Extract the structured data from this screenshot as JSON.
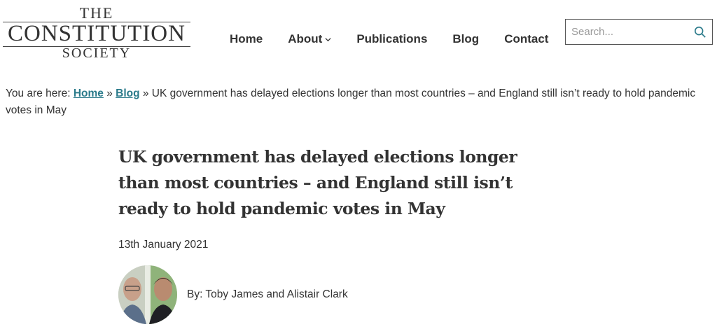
{
  "logo": {
    "line1": "THE",
    "line2": "CONSTITUTION",
    "line3": "SOCIETY"
  },
  "nav": {
    "home": "Home",
    "about": "About",
    "publications": "Publications",
    "blog": "Blog",
    "contact": "Contact"
  },
  "search": {
    "placeholder": "Search..."
  },
  "breadcrumb": {
    "prefix": "You are here: ",
    "home": "Home",
    "sep1": " » ",
    "blog": "Blog",
    "sep2": " » ",
    "current": "UK government has delayed elections longer than most countries – and England still isn’t ready to hold pandemic votes in May"
  },
  "article": {
    "title": "UK government has delayed elections longer than most countries – and England still isn’t ready to hold pandemic votes in May",
    "date": "13th January 2021",
    "byline": "By: Toby James and Alistair Clark"
  },
  "colors": {
    "link": "#2a7a8a",
    "text": "#333333"
  },
  "icons": {
    "search": "search-icon",
    "about_dropdown": "chevron-down-icon"
  }
}
